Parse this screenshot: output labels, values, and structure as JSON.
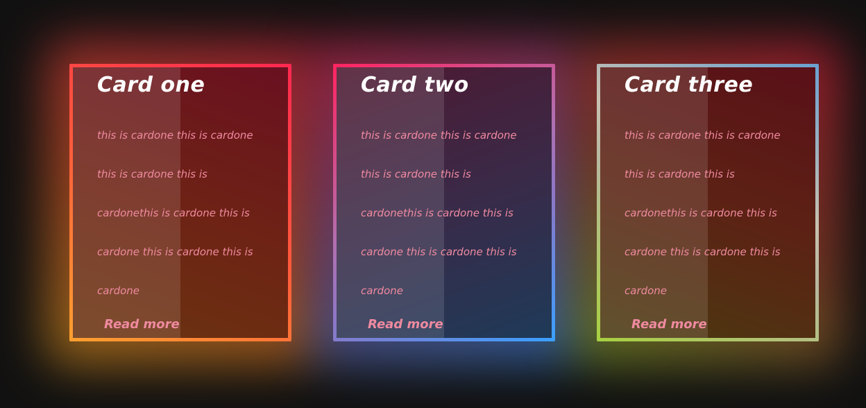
{
  "cards": [
    {
      "title": "Card one",
      "body": "this is cardone this is cardone this is cardone this is cardonethis is cardone this is cardone this is cardone this is cardone",
      "link": "Read more"
    },
    {
      "title": "Card two",
      "body": "this is cardone this is cardone this is cardone this is cardonethis is cardone this is cardone this is cardone this is cardone",
      "link": "Read more"
    },
    {
      "title": "Card three",
      "body": "this is cardone this is cardone this is cardone this is cardonethis is cardone this is cardone this is cardone this is cardone",
      "link": "Read more"
    }
  ],
  "colors": {
    "background": "#111111",
    "title": "#ffffff",
    "text": "#ef8aa0",
    "card_one_border": "#ff5a3c",
    "card_two_border": "#8a78c8",
    "card_three_border": "#b8b8a0"
  }
}
